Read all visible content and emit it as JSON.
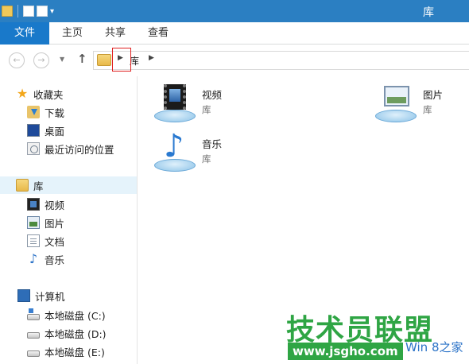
{
  "window": {
    "title": "库",
    "accent": "#2b7fc2"
  },
  "ribbon": {
    "tabs": [
      {
        "label": "文件"
      },
      {
        "label": "主页"
      },
      {
        "label": "共享"
      },
      {
        "label": "查看"
      }
    ]
  },
  "address": {
    "crumbs": [
      "库"
    ]
  },
  "sidebar": {
    "favorites": {
      "label": "收藏夹",
      "icon": "star-icon",
      "items": [
        {
          "label": "下载",
          "icon": "download-folder-icon"
        },
        {
          "label": "桌面",
          "icon": "desktop-icon"
        },
        {
          "label": "最近访问的位置",
          "icon": "recent-places-icon"
        }
      ]
    },
    "libraries": {
      "label": "库",
      "icon": "library-icon",
      "items": [
        {
          "label": "视频",
          "icon": "video-icon"
        },
        {
          "label": "图片",
          "icon": "pictures-icon"
        },
        {
          "label": "文档",
          "icon": "documents-icon"
        },
        {
          "label": "音乐",
          "icon": "music-icon"
        }
      ]
    },
    "computer": {
      "label": "计算机",
      "icon": "computer-icon",
      "items": [
        {
          "label": "本地磁盘 (C:)",
          "icon": "system-disk-icon"
        },
        {
          "label": "本地磁盘 (D:)",
          "icon": "disk-icon"
        },
        {
          "label": "本地磁盘 (E:)",
          "icon": "disk-icon"
        }
      ]
    }
  },
  "content": {
    "items": [
      {
        "name": "视频",
        "type": "库",
        "icon": "video-library-icon"
      },
      {
        "name": "图片",
        "type": "库",
        "icon": "pictures-library-icon"
      },
      {
        "name": "音乐",
        "type": "库",
        "icon": "music-library-icon"
      }
    ]
  },
  "watermark": {
    "main": "技术员联盟",
    "url": "www.jsgho.com",
    "brand": "Win 8之家"
  },
  "highlight_color": "#e02020"
}
